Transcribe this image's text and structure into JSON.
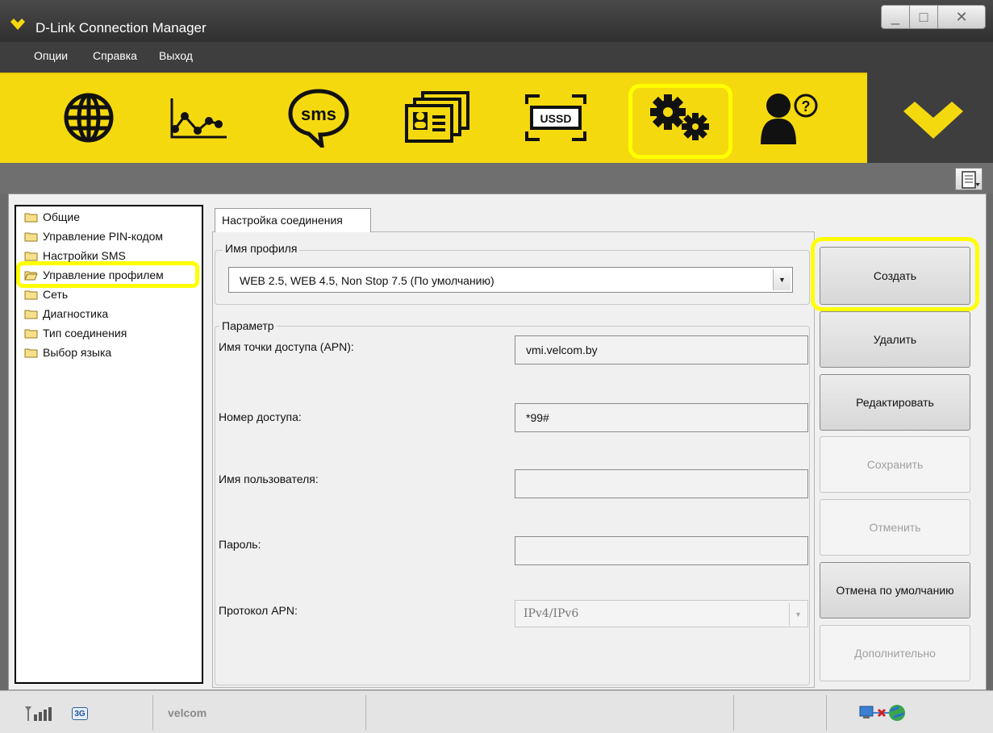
{
  "window": {
    "title": "D-Link Connection Manager",
    "minimize_glyph": "_",
    "maximize_glyph": "□",
    "close_glyph": "✕"
  },
  "menu": {
    "options": "Опции",
    "help": "Справка",
    "exit": "Выход"
  },
  "toolbar": {
    "items": [
      {
        "icon": "globe-icon"
      },
      {
        "icon": "statistics-chart-icon"
      },
      {
        "icon": "sms-icon",
        "text": "sms"
      },
      {
        "icon": "contacts-cards-icon"
      },
      {
        "icon": "ussd-icon",
        "text": "USSD"
      },
      {
        "icon": "settings-gears-icon",
        "selected": true
      },
      {
        "icon": "help-user-icon"
      }
    ],
    "brand_icon": "dlink-heart-logo-icon",
    "accent_color": "#f5d90f",
    "highlight_color": "#ffff00"
  },
  "tree": {
    "items": [
      {
        "label": "Общие"
      },
      {
        "label": "Управление PIN-кодом"
      },
      {
        "label": "Настройки SMS"
      },
      {
        "label": "Управление профилем",
        "selected": true
      },
      {
        "label": "Сеть"
      },
      {
        "label": "Диагностика"
      },
      {
        "label": "Тип соединения"
      },
      {
        "label": "Выбор языка"
      }
    ]
  },
  "tab": {
    "label": "Настройка соединения"
  },
  "profile": {
    "group_label": "Имя профиля",
    "selected": "WEB 2.5, WEB 4.5, Non Stop 7.5 (По умолчанию)"
  },
  "params": {
    "group_label": "Параметр",
    "apn_label": "Имя точки доступа (APN):",
    "apn_value": "vmi.velcom.by",
    "number_label": "Номер доступа:",
    "number_value": "*99#",
    "username_label": "Имя пользователя:",
    "username_value": "",
    "password_label": "Пароль:",
    "password_value": "",
    "protocol_label": "Протокол APN:",
    "protocol_value": "IPv4/IPv6"
  },
  "buttons": {
    "create": "Создать",
    "delete": "Удалить",
    "edit": "Редактировать",
    "save": "Сохранить",
    "cancel": "Отменить",
    "reset_default": "Отмена по умолчанию",
    "advanced": "Дополнительно"
  },
  "status": {
    "network_type": "3G",
    "operator": "velcom"
  }
}
